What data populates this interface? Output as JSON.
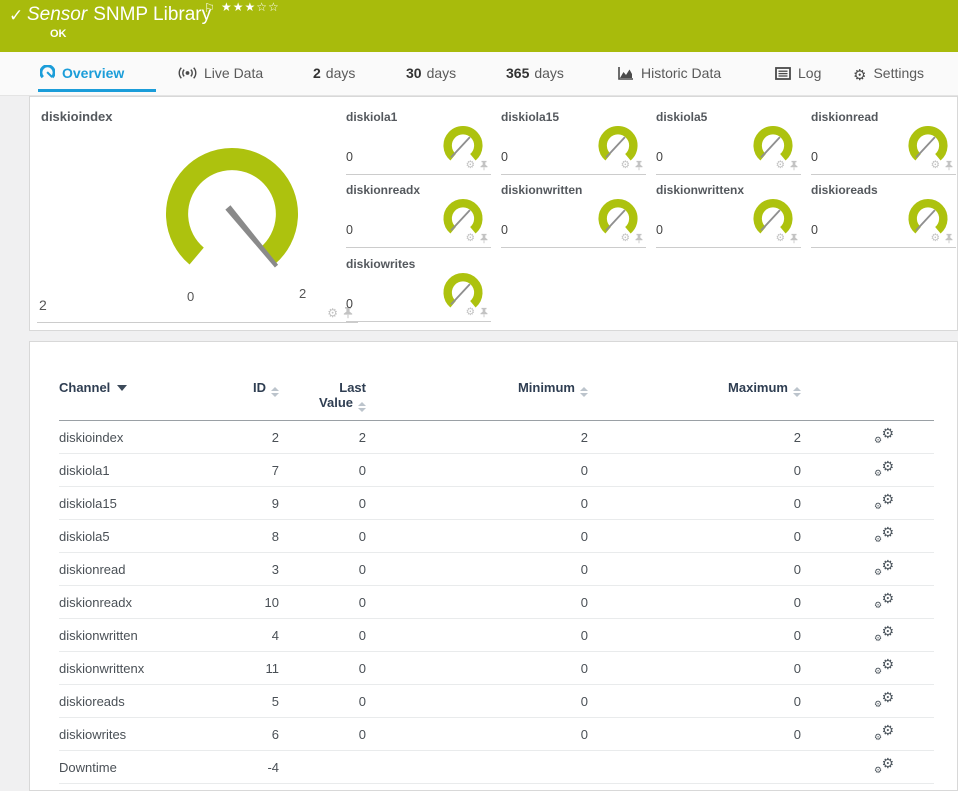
{
  "topbar": {
    "check": "✓",
    "title_em": "Sensor",
    "title": "SNMP Library",
    "flag": "⚐",
    "stars_full": "★★★",
    "stars_empty": "☆☆",
    "status": "OK"
  },
  "tabs": {
    "overview": "Overview",
    "live": "Live Data",
    "d2_num": "2",
    "d2_label": "days",
    "d30_num": "30",
    "d30_label": "days",
    "d365_num": "365",
    "d365_label": "days",
    "historic": "Historic Data",
    "log": "Log",
    "settings": "Settings"
  },
  "gauges": {
    "main": {
      "name": "diskioindex",
      "value": "2",
      "scale_min": "0",
      "scale_max": "2"
    },
    "small": [
      {
        "name": "diskiola1",
        "value": "0"
      },
      {
        "name": "diskiola15",
        "value": "0"
      },
      {
        "name": "diskiola5",
        "value": "0"
      },
      {
        "name": "diskionread",
        "value": "0"
      },
      {
        "name": "diskionreadx",
        "value": "0"
      },
      {
        "name": "diskionwritten",
        "value": "0"
      },
      {
        "name": "diskionwrittenx",
        "value": "0"
      },
      {
        "name": "diskioreads",
        "value": "0"
      },
      {
        "name": "diskiowrites",
        "value": "0"
      }
    ]
  },
  "table": {
    "headers": {
      "channel": "Channel",
      "id": "ID",
      "last_line1": "Last",
      "last_line2": "Value",
      "min": "Minimum",
      "max": "Maximum"
    },
    "rows": [
      {
        "channel": "diskioindex",
        "id": "2",
        "last": "2",
        "min": "2",
        "max": "2"
      },
      {
        "channel": "diskiola1",
        "id": "7",
        "last": "0",
        "min": "0",
        "max": "0"
      },
      {
        "channel": "diskiola15",
        "id": "9",
        "last": "0",
        "min": "0",
        "max": "0"
      },
      {
        "channel": "diskiola5",
        "id": "8",
        "last": "0",
        "min": "0",
        "max": "0"
      },
      {
        "channel": "diskionread",
        "id": "3",
        "last": "0",
        "min": "0",
        "max": "0"
      },
      {
        "channel": "diskionreadx",
        "id": "10",
        "last": "0",
        "min": "0",
        "max": "0"
      },
      {
        "channel": "diskionwritten",
        "id": "4",
        "last": "0",
        "min": "0",
        "max": "0"
      },
      {
        "channel": "diskionwrittenx",
        "id": "11",
        "last": "0",
        "min": "0",
        "max": "0"
      },
      {
        "channel": "diskioreads",
        "id": "5",
        "last": "0",
        "min": "0",
        "max": "0"
      },
      {
        "channel": "diskiowrites",
        "id": "6",
        "last": "0",
        "min": "0",
        "max": "0"
      },
      {
        "channel": "Downtime",
        "id": "-4",
        "last": "",
        "min": "",
        "max": ""
      }
    ]
  },
  "colors": {
    "status_green": "#a8bb0c",
    "gauge_green": "#adc20e",
    "accent_blue": "#1b9dd9"
  }
}
